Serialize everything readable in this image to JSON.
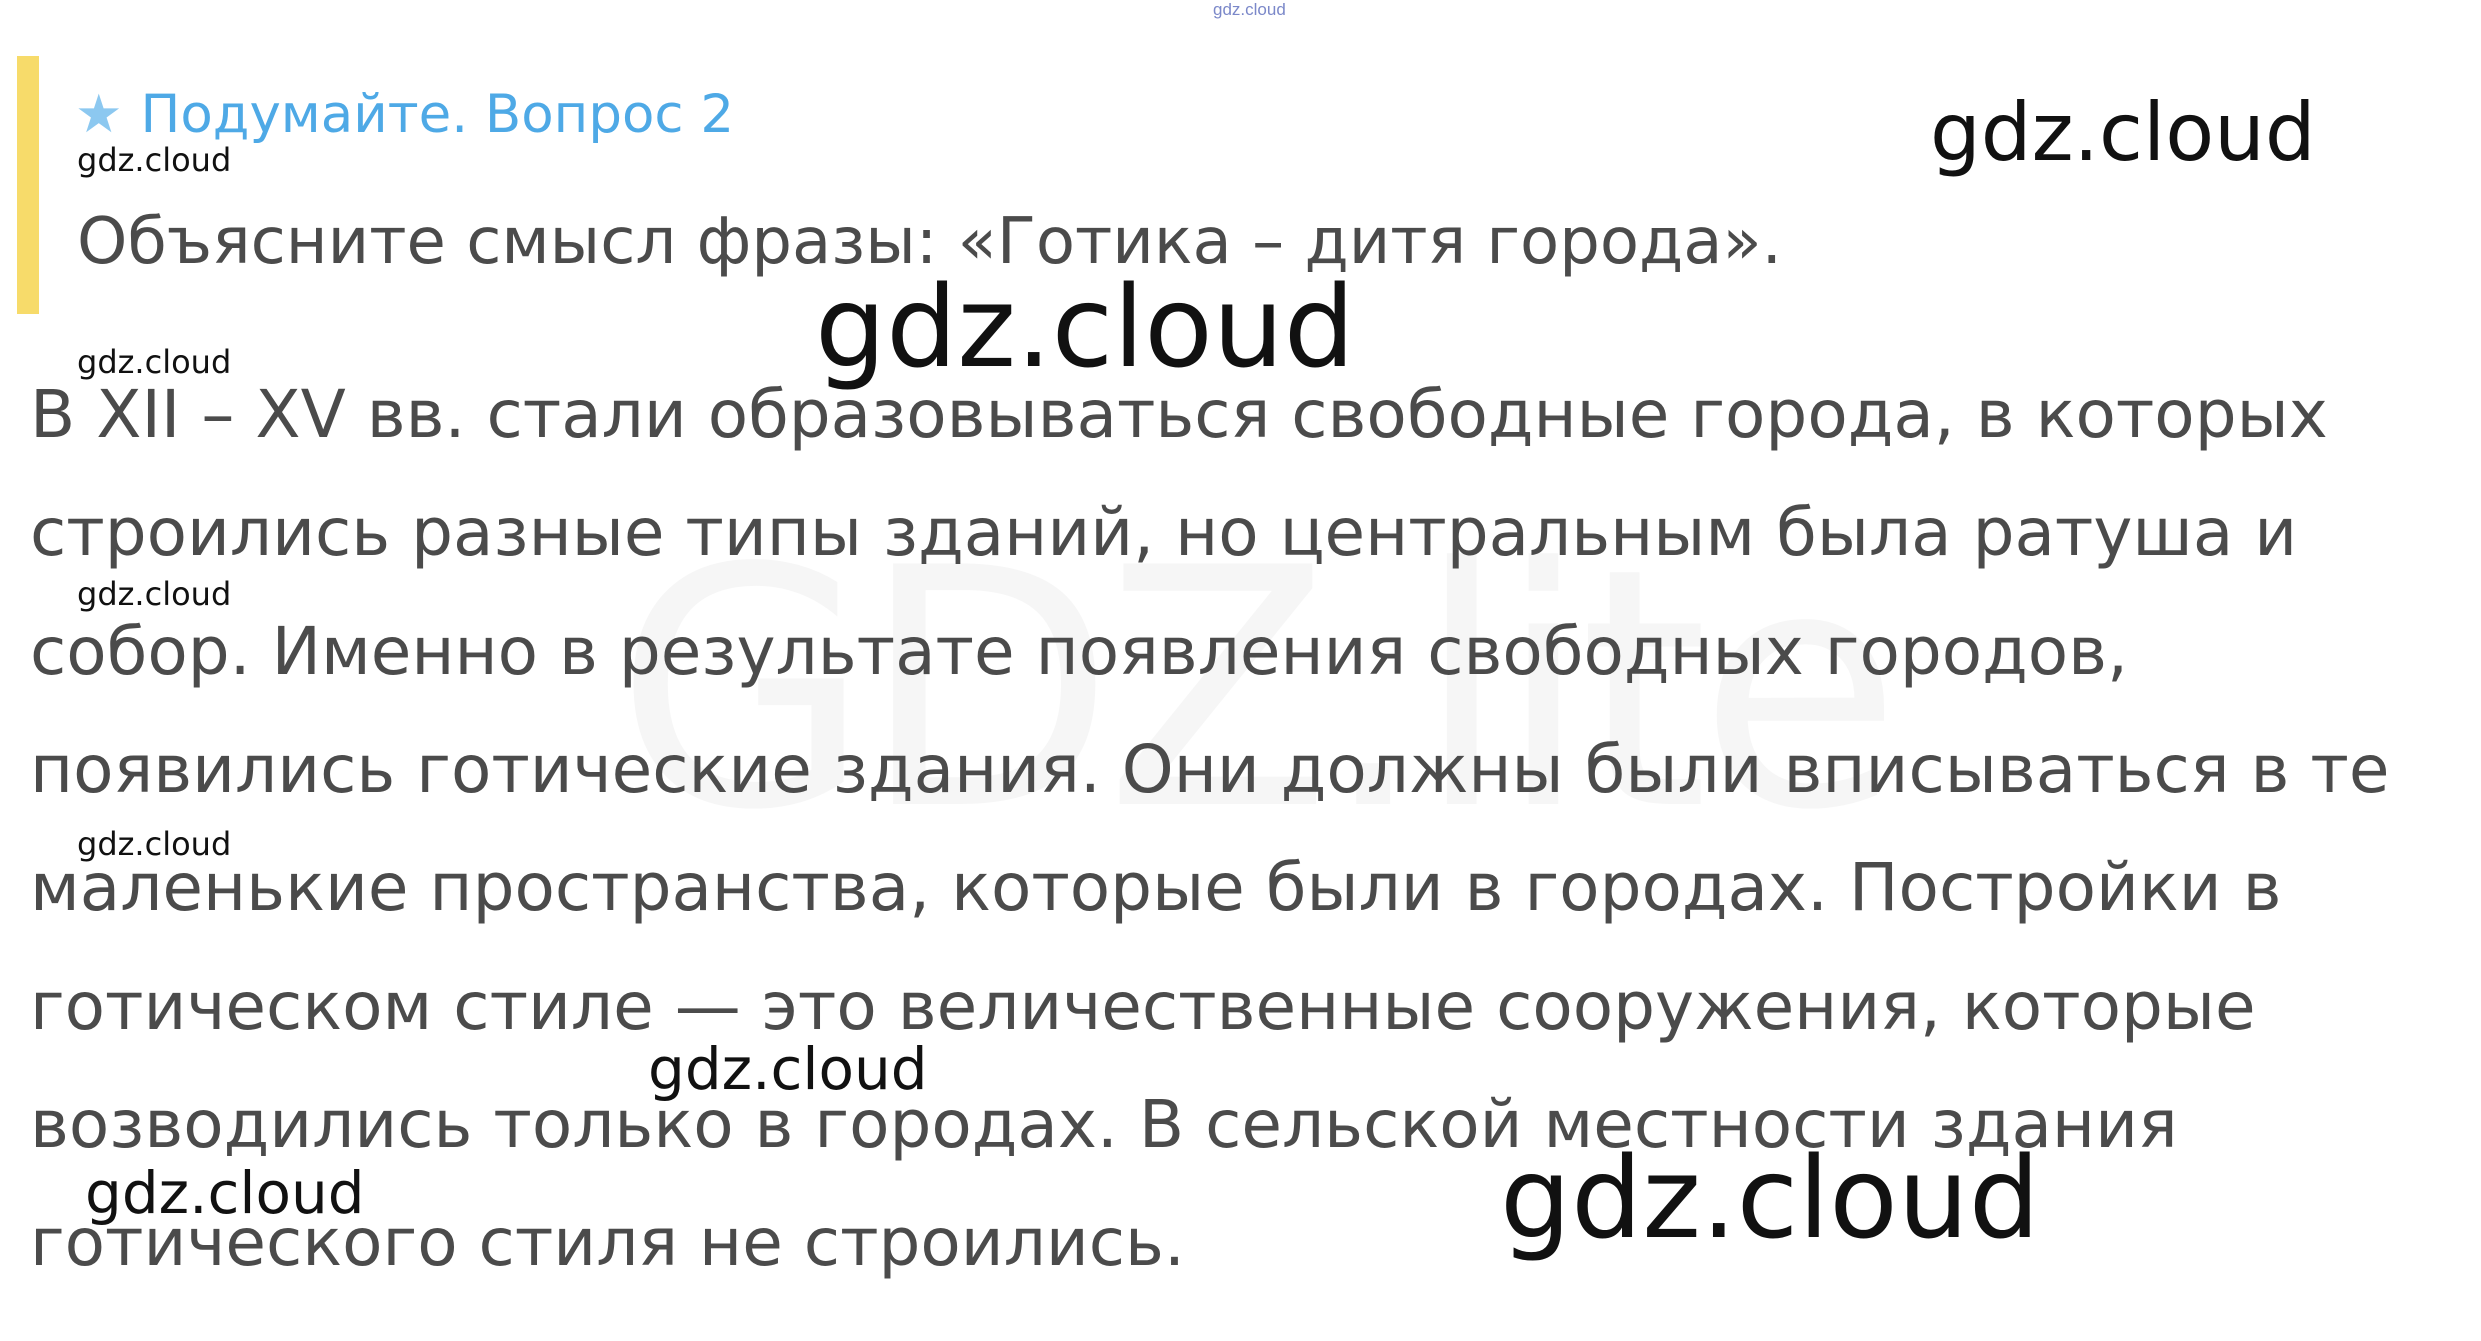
{
  "watermarks": {
    "top": "gdz.cloud",
    "background": "GDZ.lite",
    "label": "gdz.cloud"
  },
  "question": {
    "icon": "star-icon",
    "title": "Подумайте. Вопрос 2",
    "text": "Объясните смысл фразы: «Готика – дитя города»."
  },
  "answer": {
    "lines": [
      "В XII – XV вв. стали образовываться свободные города, в которых",
      "строились разные типы зданий, но центральным была ратуша и",
      "собор. Именно в результате появления свободных городов,",
      "появились готические здания. Они должны были вписываться в те",
      "маленькие пространства, которые были в городах. Постройки в",
      "готическом стиле — это величественные сооружения, которые",
      "возводились только в городах. В сельской местности здания",
      "готического стиля не строились."
    ]
  },
  "colors": {
    "accent_bar": "#f7db6a",
    "question_title": "#4ea9e6",
    "body_text": "#4b4b4b"
  }
}
